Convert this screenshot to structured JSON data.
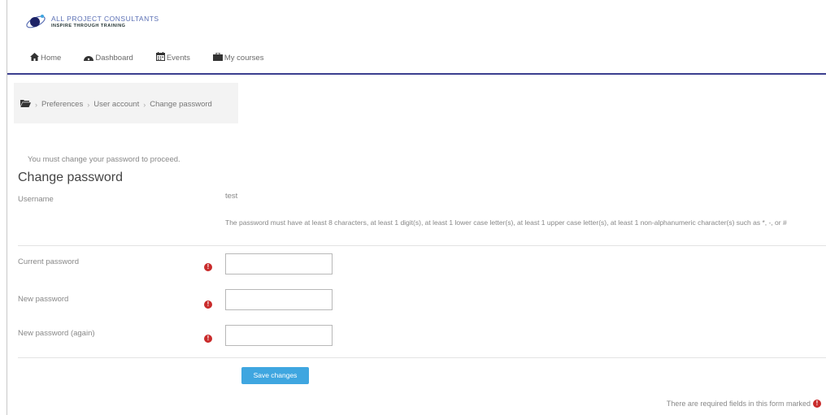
{
  "brand": {
    "line1": "ALL PROJECT CONSULTANTS",
    "line2": "INSPIRE THROUGH TRAINING",
    "accent_color": "#3b3f8f"
  },
  "nav": {
    "items": [
      {
        "label": "Home",
        "icon": "home-icon"
      },
      {
        "label": "Dashboard",
        "icon": "dashboard-icon"
      },
      {
        "label": "Events",
        "icon": "calendar-icon"
      },
      {
        "label": "My courses",
        "icon": "briefcase-icon"
      }
    ]
  },
  "breadcrumb": {
    "icon": "folder-icon",
    "items": [
      "Preferences",
      "User account",
      "Change password"
    ]
  },
  "notice": "You must change your password to proceed.",
  "form": {
    "title": "Change password",
    "username_label": "Username",
    "username_value": "test",
    "rules": "The password must have at least 8 characters, at least 1 digit(s), at least 1 lower case letter(s), at least 1 upper case letter(s), at least 1 non-alphanumeric character(s) such as *, -, or #",
    "fields": [
      {
        "label": "Current password",
        "value": ""
      },
      {
        "label": "New password",
        "value": ""
      },
      {
        "label": "New password (again)",
        "value": ""
      }
    ],
    "save_label": "Save changes",
    "required_note": "There are required fields in this form marked",
    "required_color": "#c92b2b",
    "button_color": "#3fa6e0"
  }
}
